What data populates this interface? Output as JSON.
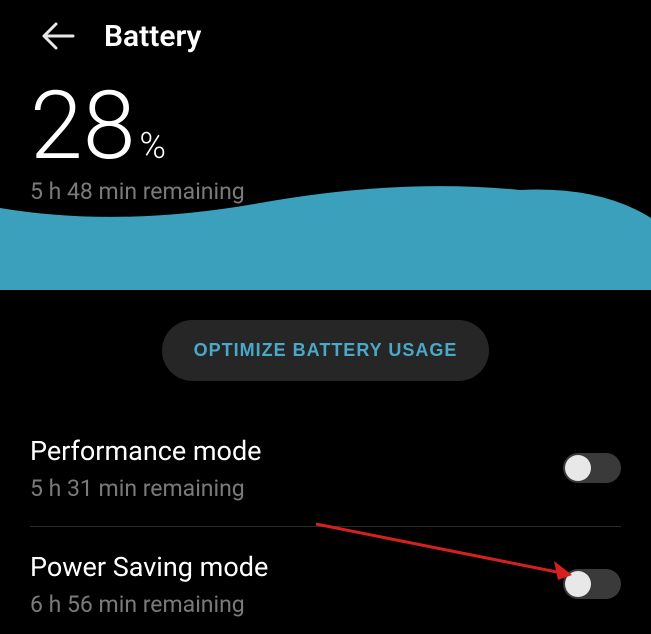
{
  "header": {
    "title": "Battery"
  },
  "battery": {
    "percentage": "28",
    "percent_sign": "%",
    "remaining": "5 h 48 min remaining"
  },
  "optimize_label": "OPTIMIZE BATTERY USAGE",
  "modes": [
    {
      "title": "Performance mode",
      "subtitle": "5 h 31 min remaining",
      "enabled": false
    },
    {
      "title": "Power Saving mode",
      "subtitle": "6 h 56 min remaining",
      "enabled": false
    }
  ],
  "colors": {
    "wave": "#3aa0bb",
    "accent": "#4aa8c9",
    "annotation": "#d62020"
  }
}
